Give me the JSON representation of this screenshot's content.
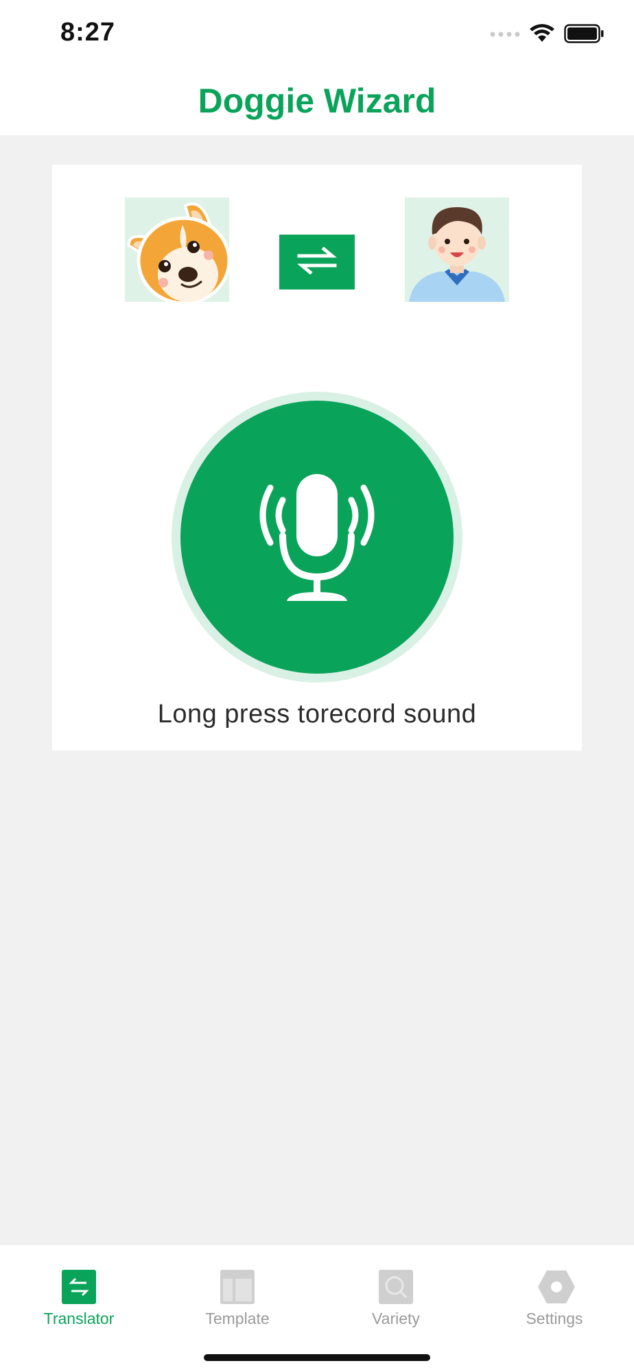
{
  "status_bar": {
    "time": "8:27",
    "icons": [
      "signal-dots-icon",
      "wifi-icon",
      "battery-icon"
    ]
  },
  "header": {
    "title": "Doggie Wizard"
  },
  "translator": {
    "source_avatar": "dog-avatar",
    "target_avatar": "human-avatar",
    "swap_icon": "swap-arrows-icon",
    "record_icon": "microphone-icon",
    "record_hint": "Long press torecord sound"
  },
  "tab_bar": {
    "items": [
      {
        "label": "Translator",
        "icon": "translate-icon",
        "active": true
      },
      {
        "label": "Template",
        "icon": "template-icon",
        "active": false
      },
      {
        "label": "Variety",
        "icon": "variety-icon",
        "active": false
      },
      {
        "label": "Settings",
        "icon": "settings-icon",
        "active": false
      }
    ]
  },
  "colors": {
    "accent": "#0aa35a",
    "accent_light": "#d9f1e5",
    "background": "#f0f1f0",
    "inactive": "#c8c8c8"
  }
}
